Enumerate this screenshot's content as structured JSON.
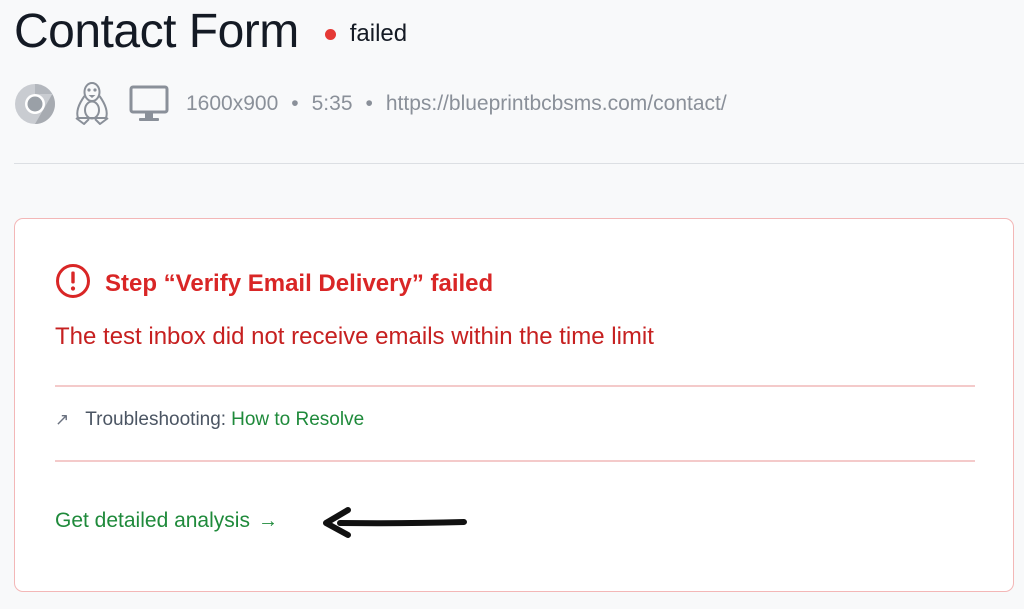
{
  "header": {
    "title": "Contact Form",
    "status": "failed",
    "status_color": "#e53935"
  },
  "meta": {
    "icons": [
      "chrome-browser-icon",
      "linux-tux-icon",
      "desktop-monitor-icon"
    ],
    "resolution": "1600x900",
    "separator": "•",
    "duration": "5:35",
    "url": "https://blueprintbcbsms.com/contact/"
  },
  "error_card": {
    "icon": "error-circle-icon",
    "title": "Step “Verify Email Delivery” failed",
    "message": "The test inbox did not receive emails within the time limit",
    "troubleshooting_arrow": "↗",
    "troubleshooting_label": "Troubleshooting:",
    "troubleshooting_link": "How to Resolve",
    "cta_label": "Get detailed analysis",
    "cta_arrow": "→",
    "accent_color": "#d92626",
    "link_color": "#1f8a3b"
  }
}
